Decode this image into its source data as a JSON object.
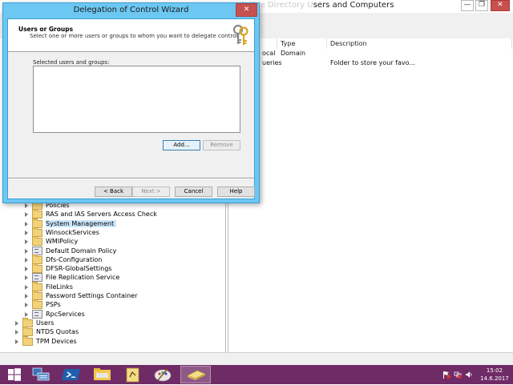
{
  "main_window": {
    "title_ghost": "Active Directory U",
    "title_visible": "sers and Computers",
    "controls": {
      "minimize": "—",
      "maximize": "❐",
      "close": "✕"
    },
    "columns": [
      "Type",
      "Description"
    ],
    "rows": [
      {
        "name_fragment": "ocal",
        "type": "Domain",
        "description": ""
      },
      {
        "name_fragment": "ueries",
        "type": "",
        "description": "Folder to store your favo..."
      }
    ]
  },
  "tree": [
    {
      "label": "Policies",
      "icon": "folder",
      "expandable": true
    },
    {
      "label": "RAS and IAS Servers Access Check",
      "icon": "folder",
      "expandable": true
    },
    {
      "label": "System Management",
      "icon": "folder",
      "expandable": true,
      "selected": true
    },
    {
      "label": "WinsockServices",
      "icon": "folder",
      "expandable": true
    },
    {
      "label": "WMIPolicy",
      "icon": "folder",
      "expandable": true
    },
    {
      "label": "Default Domain Policy",
      "icon": "policy",
      "expandable": true
    },
    {
      "label": "Dfs-Configuration",
      "icon": "folder",
      "expandable": true
    },
    {
      "label": "DFSR-GlobalSettings",
      "icon": "folder",
      "expandable": true
    },
    {
      "label": "File Replication Service",
      "icon": "special",
      "expandable": true
    },
    {
      "label": "FileLinks",
      "icon": "folder",
      "expandable": true
    },
    {
      "label": "Password Settings Container",
      "icon": "folder",
      "expandable": true
    },
    {
      "label": "PSPs",
      "icon": "folder",
      "expandable": true
    },
    {
      "label": "RpcServices",
      "icon": "special",
      "expandable": true
    },
    {
      "label": "Users",
      "icon": "folder",
      "expandable": true
    },
    {
      "label": "NTDS Quotas",
      "icon": "folder",
      "expandable": true
    },
    {
      "label": "TPM Devices",
      "icon": "folder",
      "expandable": true
    }
  ],
  "dialog": {
    "title": "Delegation of Control Wizard",
    "close": "✕",
    "header_title": "Users or Groups",
    "header_subtitle": "Select one or more users or groups to whom you want to delegate control.",
    "selected_label": "Selected users and groups:",
    "buttons": {
      "add": "Add...",
      "remove": "Remove",
      "back": "< Back",
      "next": "Next >",
      "cancel": "Cancel",
      "help": "Help"
    }
  },
  "taskbar": {
    "apps": [
      "windows-start",
      "server-manager",
      "powershell",
      "file-explorer",
      "active-directory",
      "paint",
      "delegation-wizard"
    ],
    "clock_time": "15:02",
    "clock_date": "14.6.2017"
  },
  "colors": {
    "dialog_frame": "#6cc7f2",
    "taskbar": "#6f2b66",
    "close_button": "#c75050",
    "folder": "#f2d27a"
  }
}
